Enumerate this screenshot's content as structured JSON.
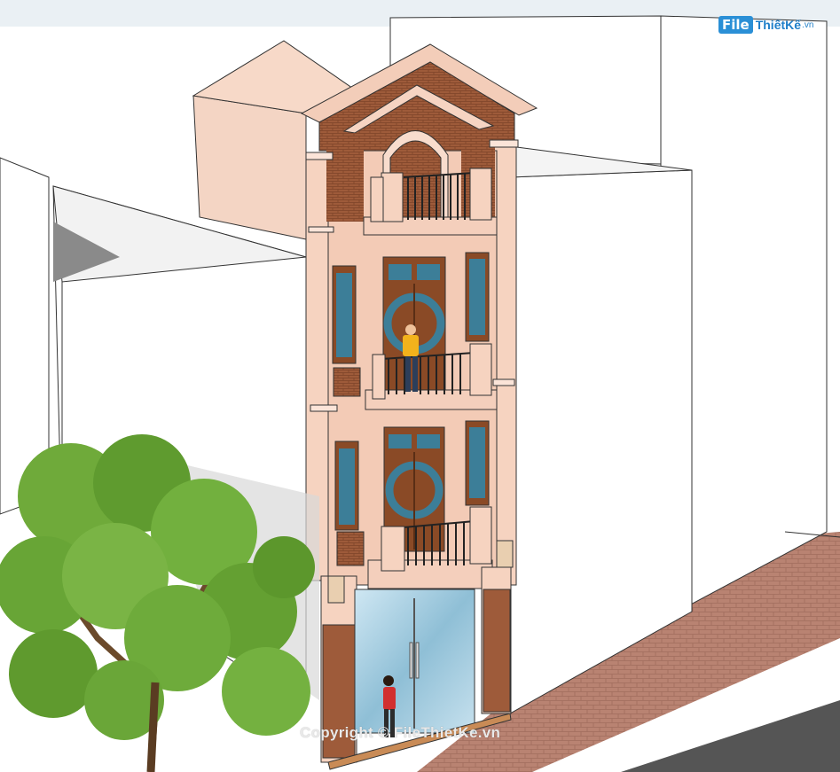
{
  "logo": {
    "badge": "File",
    "text": "ThiếtKế",
    "suffix": ".vn"
  },
  "watermark": "Copyright © FileThietKe.vn",
  "colors": {
    "sky": "#ecf2f6",
    "facade": "#f6d3c0",
    "brick": "#9e5b3a",
    "door": "#8a4a26",
    "glass": "#9fcbe0",
    "sidewalk": "#b88070",
    "tree": "#6faa3a",
    "person_shirt": "#f2b21c",
    "person_coat": "#d22f2f"
  }
}
